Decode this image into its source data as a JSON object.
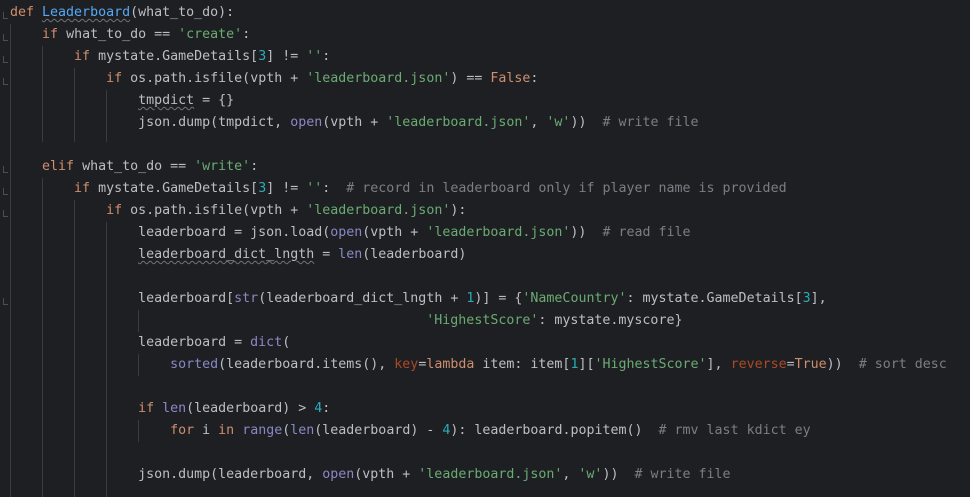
{
  "editor": {
    "language": "python",
    "lines": [
      {
        "n": 1,
        "tokens": [
          {
            "t": "def ",
            "c": "kw"
          },
          {
            "t": "Leaderboard",
            "c": "defname"
          },
          {
            "t": "(what_to_do):",
            "c": "text"
          }
        ]
      },
      {
        "n": 2,
        "tokens": [
          {
            "t": "    ",
            "c": "text"
          },
          {
            "t": "if ",
            "c": "kw"
          },
          {
            "t": "what_to_do == ",
            "c": "text"
          },
          {
            "t": "'create'",
            "c": "str"
          },
          {
            "t": ":",
            "c": "text"
          }
        ]
      },
      {
        "n": 3,
        "tokens": [
          {
            "t": "        ",
            "c": "text"
          },
          {
            "t": "if ",
            "c": "kw"
          },
          {
            "t": "mystate.GameDetails[",
            "c": "text"
          },
          {
            "t": "3",
            "c": "num"
          },
          {
            "t": "] != ",
            "c": "text"
          },
          {
            "t": "''",
            "c": "str"
          },
          {
            "t": ":",
            "c": "text"
          }
        ]
      },
      {
        "n": 4,
        "tokens": [
          {
            "t": "            ",
            "c": "text"
          },
          {
            "t": "if ",
            "c": "kw"
          },
          {
            "t": "os.path.isfile(vpth + ",
            "c": "text"
          },
          {
            "t": "'leaderboard.json'",
            "c": "str"
          },
          {
            "t": ") == ",
            "c": "text"
          },
          {
            "t": "False",
            "c": "kw"
          },
          {
            "t": ":",
            "c": "text"
          }
        ]
      },
      {
        "n": 5,
        "tokens": [
          {
            "t": "                ",
            "c": "text"
          },
          {
            "t": "tmpdict",
            "c": "squiggle"
          },
          {
            "t": " = {}",
            "c": "text"
          }
        ]
      },
      {
        "n": 6,
        "tokens": [
          {
            "t": "                ",
            "c": "text"
          },
          {
            "t": "json.dump(tmpdict, ",
            "c": "text"
          },
          {
            "t": "open",
            "c": "bi"
          },
          {
            "t": "(vpth + ",
            "c": "text"
          },
          {
            "t": "'leaderboard.json'",
            "c": "str"
          },
          {
            "t": ", ",
            "c": "text"
          },
          {
            "t": "'w'",
            "c": "str"
          },
          {
            "t": "))  ",
            "c": "text"
          },
          {
            "t": "# write file",
            "c": "cmt"
          }
        ]
      },
      {
        "n": 7,
        "tokens": []
      },
      {
        "n": 8,
        "tokens": [
          {
            "t": "    ",
            "c": "text"
          },
          {
            "t": "elif ",
            "c": "kw"
          },
          {
            "t": "what_to_do == ",
            "c": "text"
          },
          {
            "t": "'write'",
            "c": "str"
          },
          {
            "t": ":",
            "c": "text"
          }
        ]
      },
      {
        "n": 9,
        "tokens": [
          {
            "t": "        ",
            "c": "text"
          },
          {
            "t": "if ",
            "c": "kw"
          },
          {
            "t": "mystate.GameDetails[",
            "c": "text"
          },
          {
            "t": "3",
            "c": "num"
          },
          {
            "t": "] != ",
            "c": "text"
          },
          {
            "t": "''",
            "c": "str"
          },
          {
            "t": ":  ",
            "c": "text"
          },
          {
            "t": "# record in leaderboard only if player name is provided",
            "c": "cmt"
          }
        ]
      },
      {
        "n": 10,
        "tokens": [
          {
            "t": "            ",
            "c": "text"
          },
          {
            "t": "if ",
            "c": "kw"
          },
          {
            "t": "os.path.isfile(vpth + ",
            "c": "text"
          },
          {
            "t": "'leaderboard.json'",
            "c": "str"
          },
          {
            "t": "):",
            "c": "text"
          }
        ]
      },
      {
        "n": 11,
        "tokens": [
          {
            "t": "                ",
            "c": "text"
          },
          {
            "t": "leaderboard = json.load(",
            "c": "text"
          },
          {
            "t": "open",
            "c": "bi"
          },
          {
            "t": "(vpth + ",
            "c": "text"
          },
          {
            "t": "'leaderboard.json'",
            "c": "str"
          },
          {
            "t": "))  ",
            "c": "text"
          },
          {
            "t": "# read file",
            "c": "cmt"
          }
        ]
      },
      {
        "n": 12,
        "tokens": [
          {
            "t": "                ",
            "c": "text"
          },
          {
            "t": "leaderboard_dict_lngth",
            "c": "squiggle"
          },
          {
            "t": " = ",
            "c": "text"
          },
          {
            "t": "len",
            "c": "bi"
          },
          {
            "t": "(leaderboard)",
            "c": "text"
          }
        ]
      },
      {
        "n": 13,
        "tokens": []
      },
      {
        "n": 14,
        "tokens": [
          {
            "t": "                ",
            "c": "text"
          },
          {
            "t": "leaderboard[",
            "c": "text"
          },
          {
            "t": "str",
            "c": "bi"
          },
          {
            "t": "(leaderboard_dict_lngth + ",
            "c": "text"
          },
          {
            "t": "1",
            "c": "num"
          },
          {
            "t": ")] = {",
            "c": "text"
          },
          {
            "t": "'NameCountry'",
            "c": "str"
          },
          {
            "t": ": mystate.GameDetails[",
            "c": "text"
          },
          {
            "t": "3",
            "c": "num"
          },
          {
            "t": "],",
            "c": "text"
          }
        ]
      },
      {
        "n": 15,
        "tokens": [
          {
            "t": "                                                    ",
            "c": "text"
          },
          {
            "t": "'HighestScore'",
            "c": "str"
          },
          {
            "t": ": mystate.myscore}",
            "c": "text"
          }
        ]
      },
      {
        "n": 16,
        "tokens": [
          {
            "t": "                ",
            "c": "text"
          },
          {
            "t": "leaderboard = ",
            "c": "text"
          },
          {
            "t": "dict",
            "c": "bi"
          },
          {
            "t": "(",
            "c": "text"
          }
        ]
      },
      {
        "n": 17,
        "tokens": [
          {
            "t": "                    ",
            "c": "text"
          },
          {
            "t": "sorted",
            "c": "bi"
          },
          {
            "t": "(leaderboard.items(), ",
            "c": "text"
          },
          {
            "t": "key",
            "c": "param"
          },
          {
            "t": "=",
            "c": "text"
          },
          {
            "t": "lambda ",
            "c": "kw"
          },
          {
            "t": "item: item[",
            "c": "text"
          },
          {
            "t": "1",
            "c": "num"
          },
          {
            "t": "][",
            "c": "text"
          },
          {
            "t": "'HighestScore'",
            "c": "str"
          },
          {
            "t": "], ",
            "c": "text"
          },
          {
            "t": "reverse",
            "c": "param"
          },
          {
            "t": "=",
            "c": "text"
          },
          {
            "t": "True",
            "c": "kw"
          },
          {
            "t": "))  ",
            "c": "text"
          },
          {
            "t": "# sort desc",
            "c": "cmt"
          }
        ]
      },
      {
        "n": 18,
        "tokens": []
      },
      {
        "n": 19,
        "tokens": [
          {
            "t": "                ",
            "c": "text"
          },
          {
            "t": "if ",
            "c": "kw"
          },
          {
            "t": "len",
            "c": "bi"
          },
          {
            "t": "(leaderboard) > ",
            "c": "text"
          },
          {
            "t": "4",
            "c": "num"
          },
          {
            "t": ":",
            "c": "text"
          }
        ]
      },
      {
        "n": 20,
        "tokens": [
          {
            "t": "                    ",
            "c": "text"
          },
          {
            "t": "for ",
            "c": "kw"
          },
          {
            "t": "i ",
            "c": "text"
          },
          {
            "t": "in ",
            "c": "kw"
          },
          {
            "t": "range",
            "c": "bi"
          },
          {
            "t": "(",
            "c": "text"
          },
          {
            "t": "len",
            "c": "bi"
          },
          {
            "t": "(leaderboard) - ",
            "c": "text"
          },
          {
            "t": "4",
            "c": "num"
          },
          {
            "t": "): leaderboard.popitem()  ",
            "c": "text"
          },
          {
            "t": "# rmv last kdict ey",
            "c": "cmt"
          }
        ]
      },
      {
        "n": 21,
        "tokens": []
      },
      {
        "n": 22,
        "tokens": [
          {
            "t": "                ",
            "c": "text"
          },
          {
            "t": "json.dump(leaderboard, ",
            "c": "text"
          },
          {
            "t": "open",
            "c": "bi"
          },
          {
            "t": "(vpth + ",
            "c": "text"
          },
          {
            "t": "'leaderboard.json'",
            "c": "str"
          },
          {
            "t": ", ",
            "c": "text"
          },
          {
            "t": "'w'",
            "c": "str"
          },
          {
            "t": "))  ",
            "c": "text"
          },
          {
            "t": "# write file",
            "c": "cmt"
          }
        ]
      }
    ]
  }
}
